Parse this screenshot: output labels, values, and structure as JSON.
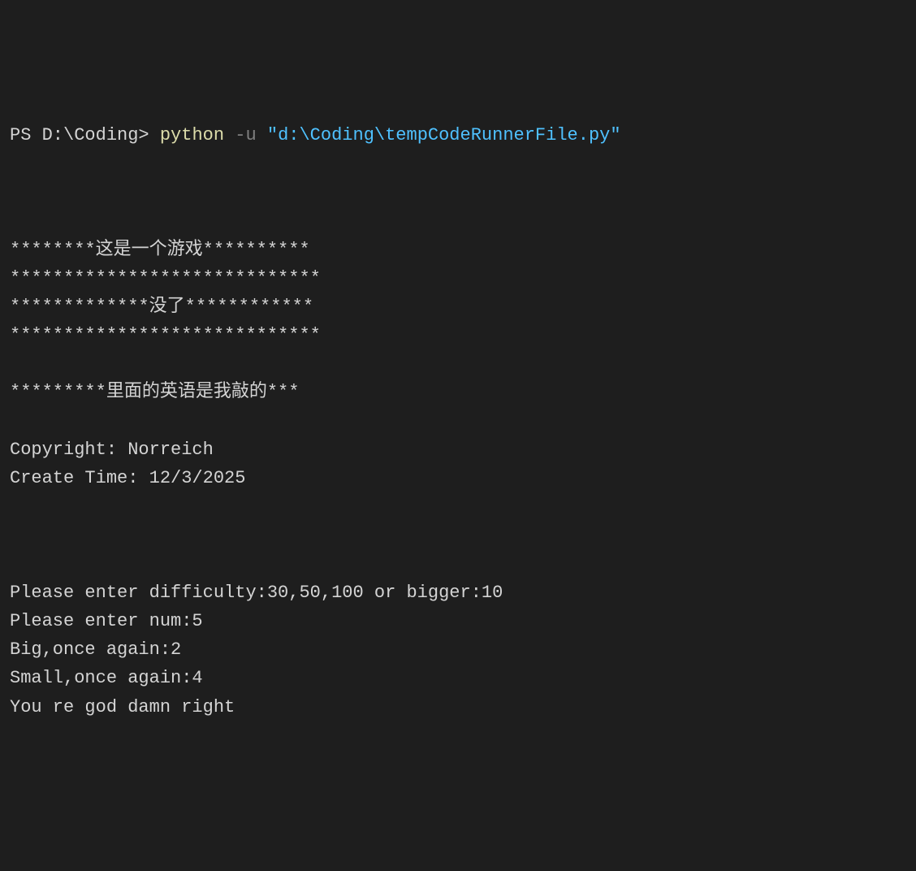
{
  "prompt": {
    "prefix": "PS D:\\Coding> ",
    "command": "python",
    "flag": " -u ",
    "path": "\"d:\\Coding\\tempCodeRunnerFile.py\""
  },
  "output": {
    "line1": "********这是一个游戏**********",
    "line2": "*****************************",
    "line3": "*************没了************",
    "line4": "*****************************",
    "line5": "*********里面的英语是我敲的***",
    "copyright": "Copyright: Norreich",
    "createTime": "Create Time: 12/3/2025",
    "diffPrompt": "Please enter difficulty:30,50,100 or bigger:10",
    "numPrompt": "Please enter num:5",
    "bigFeedback": "Big,once again:2",
    "smallFeedback": "Small,once again:4",
    "success": "You re god damn right"
  }
}
